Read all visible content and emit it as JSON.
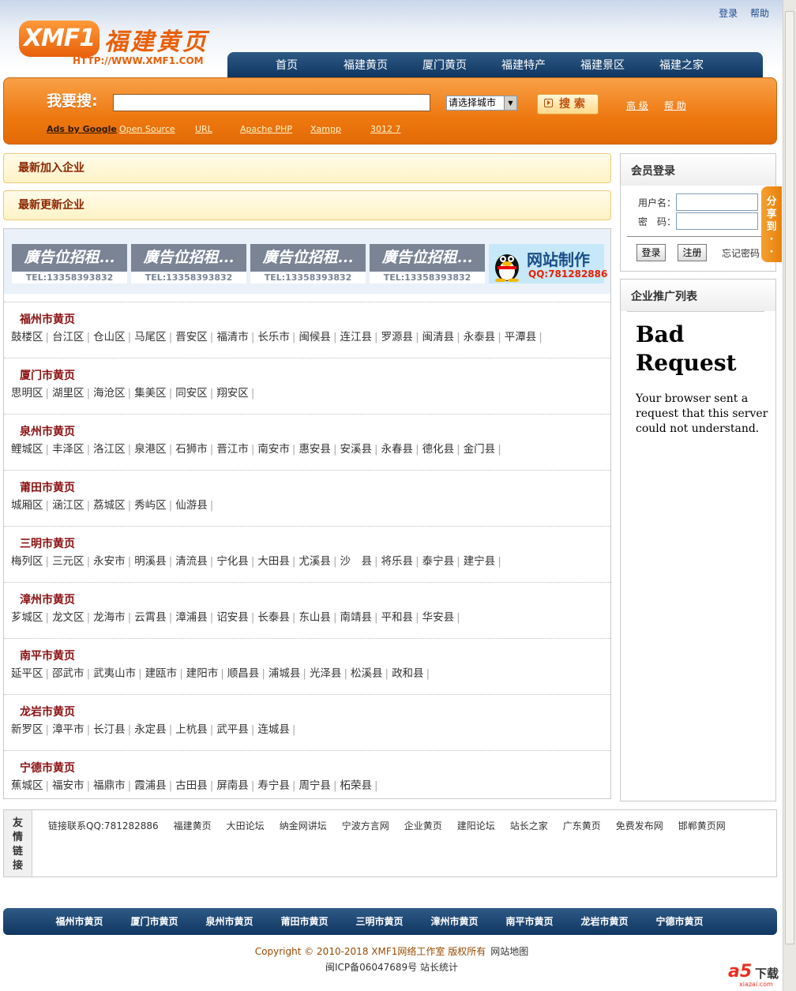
{
  "header": {
    "top_links": [
      "登录",
      "帮助"
    ],
    "logo_text": "XMF1",
    "logo_cn": "福建黄页",
    "logo_url": "HTTP://WWW.XMF1.COM",
    "nav": [
      "首页",
      "福建黄页",
      "厦门黄页",
      "福建特产",
      "福建景区",
      "福建之家"
    ]
  },
  "search": {
    "label": "我要搜:",
    "input_value": "",
    "city_select": "请选择城市",
    "button": "搜 索",
    "advanced": "高 级",
    "help": "帮 助",
    "ads_title": "Ads by Google",
    "ad_links": [
      "Open Source",
      "URL",
      "Apache PHP",
      "Xampp",
      "3012 7"
    ]
  },
  "notices": {
    "newest": "最新加入企业",
    "updated": "最新更新企业"
  },
  "banners": {
    "ad_text": "廣告位招租...",
    "ad_tel": "TEL:13358393832",
    "qq_title": "网站制作",
    "qq_number": "QQ:781282886"
  },
  "regions": [
    {
      "title": "福州市黄页",
      "districts": [
        "鼓楼区",
        "台江区",
        "仓山区",
        "马尾区",
        "晋安区",
        "福清市",
        "长乐市",
        "闽候县",
        "连江县",
        "罗源县",
        "闽清县",
        "永泰县",
        "平潭县"
      ]
    },
    {
      "title": "厦门市黄页",
      "districts": [
        "思明区",
        "湖里区",
        "海沧区",
        "集美区",
        "同安区",
        "翔安区"
      ]
    },
    {
      "title": "泉州市黄页",
      "districts": [
        "鲤城区",
        "丰泽区",
        "洛江区",
        "泉港区",
        "石狮市",
        "晋江市",
        "南安市",
        "惠安县",
        "安溪县",
        "永春县",
        "德化县",
        "金门县"
      ]
    },
    {
      "title": "莆田市黄页",
      "districts": [
        "城厢区",
        "涵江区",
        "荔城区",
        "秀屿区",
        "仙游县"
      ]
    },
    {
      "title": "三明市黄页",
      "districts": [
        "梅列区",
        "三元区",
        "永安市",
        "明溪县",
        "清流县",
        "宁化县",
        "大田县",
        "尤溪县",
        "沙　县",
        "将乐县",
        "泰宁县",
        "建宁县"
      ]
    },
    {
      "title": "漳州市黄页",
      "districts": [
        "芗城区",
        "龙文区",
        "龙海市",
        "云霄县",
        "漳浦县",
        "诏安县",
        "长泰县",
        "东山县",
        "南靖县",
        "平和县",
        "华安县"
      ]
    },
    {
      "title": "南平市黄页",
      "districts": [
        "延平区",
        "邵武市",
        "武夷山市",
        "建瓯市",
        "建阳市",
        "顺昌县",
        "浦城县",
        "光泽县",
        "松溪县",
        "政和县"
      ]
    },
    {
      "title": "龙岩市黄页",
      "districts": [
        "新罗区",
        "漳平市",
        "长汀县",
        "永定县",
        "上杭县",
        "武平县",
        "连城县"
      ]
    },
    {
      "title": "宁德市黄页",
      "districts": [
        "蕉城区",
        "福安市",
        "福鼎市",
        "霞浦县",
        "古田县",
        "屏南县",
        "寿宁县",
        "周宁县",
        "柘荣县"
      ]
    }
  ],
  "sidebar": {
    "login_title": "会员登录",
    "username_label": "用户名：",
    "password_label": "密　码：",
    "login_button": "登录",
    "register_button": "注册",
    "forgot": "忘记密码",
    "share_tab": [
      "分",
      "享",
      "到",
      "·",
      "·"
    ],
    "promo_title": "企业推广列表",
    "bad_request_title": "Bad Request",
    "bad_request_text": "Your browser sent a request that this server could not understand."
  },
  "friend_links": {
    "label": [
      "友",
      "情",
      "链",
      "接"
    ],
    "items": [
      "链接联系QQ:781282886",
      "福建黄页",
      "大田论坛",
      "纳金网讲坛",
      "宁波方言网",
      "企业黄页",
      "建阳论坛",
      "站长之家",
      "广东黄页",
      "免费发布网",
      "邯郸黄页网"
    ]
  },
  "footer": {
    "nav": [
      "福州市黄页",
      "厦门市黄页",
      "泉州市黄页",
      "莆田市黄页",
      "三明市黄页",
      "漳州市黄页",
      "南平市黄页",
      "龙岩市黄页",
      "宁德市黄页"
    ],
    "copyright": "Copyright © 2010-2018 XMF1网络工作室 版权所有",
    "sitemap": "网站地图",
    "icp": "闽ICP备06047689号",
    "stats": "站长统计"
  },
  "watermark": {
    "brand": "a5",
    "text": "下载",
    "domain": "xiazai.com"
  }
}
